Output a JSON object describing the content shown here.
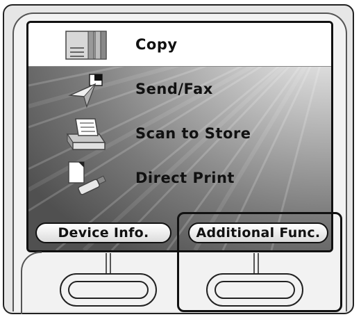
{
  "menu": {
    "items": [
      {
        "label": "Copy",
        "icon": "copy-icon",
        "selected": true
      },
      {
        "label": "Send/Fax",
        "icon": "send-fax-icon",
        "selected": false
      },
      {
        "label": "Scan to Store",
        "icon": "scan-to-store-icon",
        "selected": false
      },
      {
        "label": "Direct Print",
        "icon": "direct-print-icon",
        "selected": false
      }
    ]
  },
  "soft_buttons": {
    "device_info_label": "Device Info.",
    "additional_func_label": "Additional Func."
  },
  "colors": {
    "frame": "#222222",
    "screen_bg": "#6b6b6b",
    "selected_bg": "#ffffff",
    "highlight": "#111111"
  }
}
